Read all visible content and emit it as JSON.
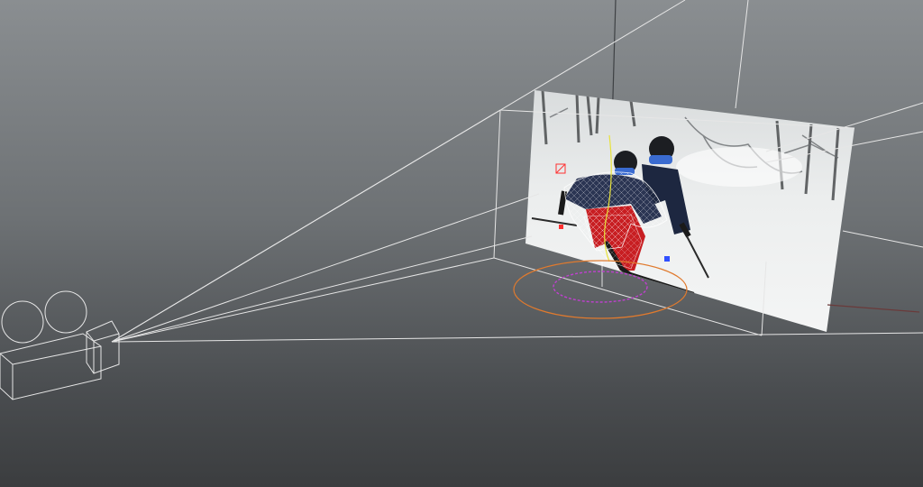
{
  "viewport": {
    "background_top": "#8a8e91",
    "background_bottom": "#3b3d3f"
  },
  "scene": {
    "camera_icon": "movie-camera-wireframe",
    "frustum_color": "#e6e6e6",
    "image_plane_subject": "skier-in-snow",
    "rig_wireframe_color": "#ffffff",
    "spine_curve_color": "#e8e23a",
    "ground_ring_outer_color": "#e07a2e",
    "ground_ring_inner_color": "#c040d0",
    "locator_colors": [
      "#ff3030",
      "#3050ff"
    ]
  }
}
